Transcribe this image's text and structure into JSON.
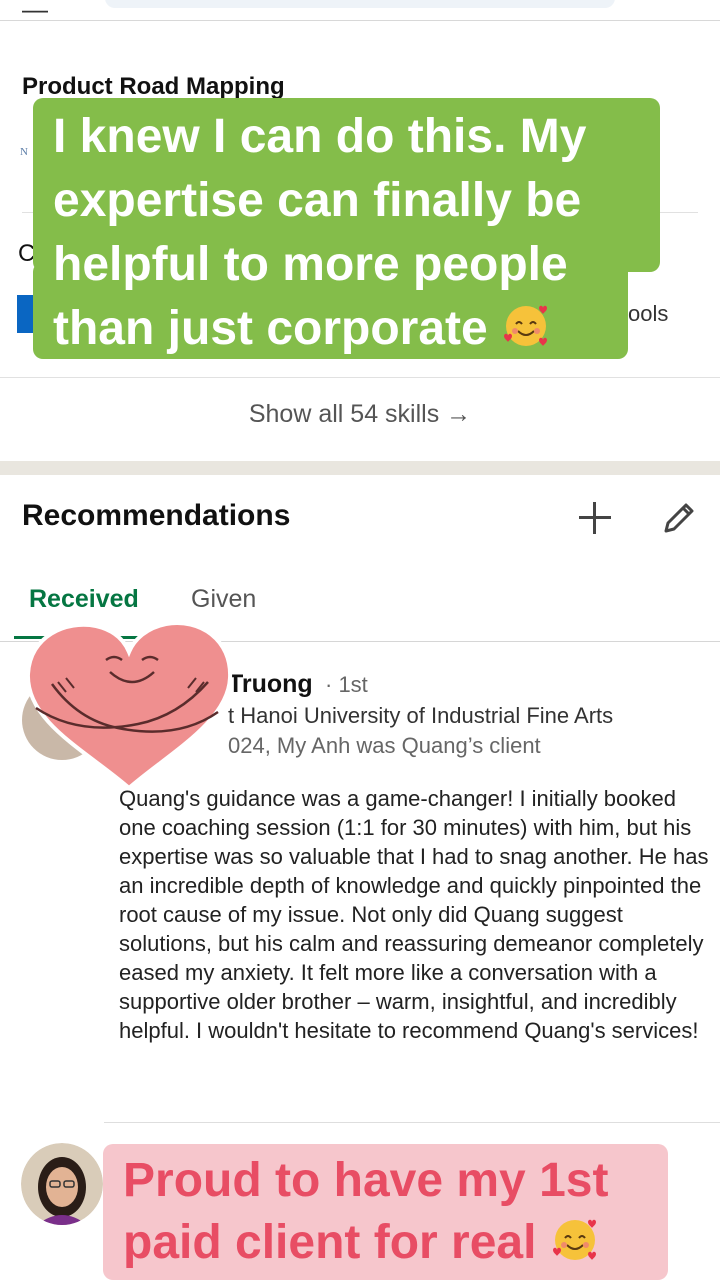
{
  "skills": {
    "skill_title": "Product Road Mapping",
    "endorsement_stub": "N",
    "next_stub": "C",
    "tools_stub": "ools",
    "show_all": "Show all 54 skills →"
  },
  "overlay_top": {
    "lines": [
      "I knew I can do this. My",
      "expertise can finally be",
      "helpful to more people",
      "than just corporate"
    ],
    "emoji": "smiling-face-with-hearts"
  },
  "recommendations": {
    "title": "Recommendations",
    "tabs": [
      {
        "label": "Received",
        "active": true
      },
      {
        "label": "Given",
        "active": false
      }
    ],
    "items": [
      {
        "name": "Truong",
        "degree": "· 1st",
        "headline": "t Hanoi University of Industrial Fine Arts",
        "relation": "024, My Anh was Quang’s client",
        "body": "Quang's guidance was a game-changer! I initially booked one coaching session (1:1 for 30 minutes) with him, but his expertise was so valuable that I had to snag another. He has an incredible depth of knowledge and quickly pinpointed the root cause of my issue. Not only did Quang suggest solutions, but his calm and reassuring demeanor completely eased my anxiety. It felt more like a conversation with a supportive older brother – warm, insightful, and incredibly helpful. I wouldn't hesitate to recommend Quang's services!"
      }
    ]
  },
  "overlay_bottom": {
    "lines": [
      "Proud to have my 1st",
      "paid client for real"
    ],
    "emoji": "smiling-face-with-hearts"
  },
  "colors": {
    "green_overlay": "#84bd4a",
    "pink_overlay": "#f6c6cc",
    "pink_text": "#e84d64",
    "linkedin_green": "#057642",
    "heart": "#ef8f8f"
  }
}
